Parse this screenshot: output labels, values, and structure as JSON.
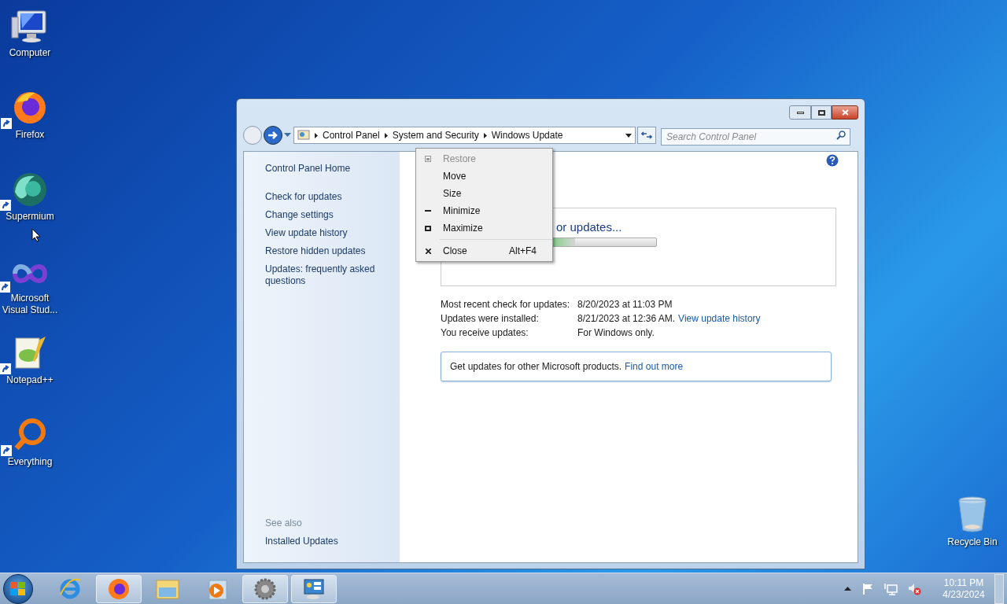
{
  "desktop_icons": [
    {
      "label": "Computer",
      "kind": "computer",
      "shortcut": false
    },
    {
      "label": "Firefox",
      "kind": "firefox",
      "shortcut": true
    },
    {
      "label": "Supermium",
      "kind": "supermium",
      "shortcut": true
    },
    {
      "label": "Microsoft\nVisual Stud...",
      "kind": "vs",
      "shortcut": true
    },
    {
      "label": "Notepad++",
      "kind": "notepad",
      "shortcut": true
    },
    {
      "label": "Everything",
      "kind": "everything",
      "shortcut": true
    },
    {
      "label": "Recycle Bin",
      "kind": "bin",
      "shortcut": false
    }
  ],
  "window": {
    "breadcrumb": [
      "Control Panel",
      "System and Security",
      "Windows Update"
    ],
    "search": {
      "placeholder": "Search Control Panel"
    },
    "sidebar": {
      "items": [
        "Control Panel Home",
        "Check for updates",
        "Change settings",
        "View update history",
        "Restore hidden updates",
        "Updates: frequently asked questions"
      ],
      "see_also_title": "See also",
      "see_also": [
        "Installed Updates"
      ]
    },
    "status": {
      "text": "or updates...",
      "level": 0.6
    },
    "info": [
      {
        "label": "Most recent check for updates:",
        "value": "8/20/2023 at 11:03 PM"
      },
      {
        "label": "Updates were installed:",
        "value": "8/21/2023 at 12:36 AM.",
        "link": "View update history"
      },
      {
        "label": "You receive updates:",
        "value": "For Windows only."
      }
    ],
    "notice": {
      "text": "Get updates for other Microsoft products.",
      "link": "Find out more"
    }
  },
  "context_menu": [
    {
      "label": "Restore",
      "kind": "restore",
      "disabled": true
    },
    {
      "label": "Move",
      "kind": "plain",
      "disabled": false
    },
    {
      "label": "Size",
      "kind": "plain",
      "disabled": false
    },
    {
      "label": "Minimize",
      "kind": "minimize",
      "disabled": false
    },
    {
      "label": "Maximize",
      "kind": "maximize",
      "disabled": false
    },
    {
      "label": "Close",
      "kind": "close",
      "disabled": false,
      "shortcut": "Alt+F4",
      "separator_before": true
    }
  ],
  "taskbar": {
    "apps": [
      {
        "kind": "ie",
        "running": false
      },
      {
        "kind": "firefox",
        "running": true
      },
      {
        "kind": "explorer",
        "running": false
      },
      {
        "kind": "media",
        "running": false
      },
      {
        "kind": "gear",
        "running": true
      },
      {
        "kind": "panel",
        "running": true
      }
    ],
    "tray": {
      "time": "10:11 PM",
      "date": "4/23/2024"
    }
  }
}
